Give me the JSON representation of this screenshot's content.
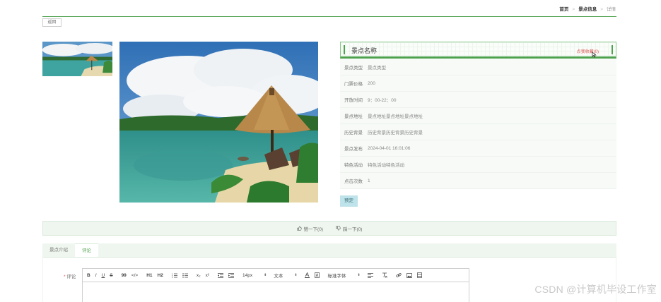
{
  "breadcrumb": {
    "home": "首页",
    "section": "景点信息",
    "current": "详情",
    "separator": ">"
  },
  "back_label": "返回",
  "spot": {
    "name": "景点名称",
    "favorite_label": "点我收藏(0)",
    "fields": [
      {
        "label": "景点类型",
        "value": "景点类型"
      },
      {
        "label": "门票价格",
        "value": "200"
      },
      {
        "label": "开放时间",
        "value": "9：00-22：00"
      },
      {
        "label": "景点地址",
        "value": "景点地址景点地址景点地址"
      },
      {
        "label": "历史背景",
        "value": "历史背景历史背景历史背景"
      },
      {
        "label": "景点发布",
        "value": "2024-04-01 16:01:06"
      },
      {
        "label": "特色活动",
        "value": "特色活动特色活动"
      },
      {
        "label": "点击次数",
        "value": "1"
      }
    ],
    "book_label": "预定"
  },
  "votes": {
    "like_label": "赞一下(0)",
    "dislike_label": "踩一下(0)"
  },
  "tabs": [
    {
      "label": "景点介绍",
      "active": false
    },
    {
      "label": "评论",
      "active": true
    }
  ],
  "comment": {
    "required_mark": "*",
    "label": "评论",
    "toolbar": {
      "bold": "B",
      "italic": "I",
      "underline": "U",
      "strike": "S",
      "blockquote": "99",
      "code": "</>",
      "h1": "H1",
      "h2": "H2",
      "sub": "x₂",
      "sup": "x²",
      "size_value": "14px",
      "format_value": "文本",
      "font_value": "标准字体",
      "caret": "⬍"
    }
  },
  "watermark": "CSDN @计算机毕设工作室",
  "colors": {
    "accent": "#4ea24e",
    "favorite": "#d9534f",
    "book_button": "#bfe3ea"
  },
  "icons": [
    "thumbs-up-icon",
    "thumbs-down-icon",
    "ordered-list-icon",
    "bullet-list-icon",
    "indent-icon",
    "outdent-icon",
    "text-color-icon",
    "background-color-icon",
    "align-icon",
    "clear-format-icon",
    "link-icon",
    "image-icon",
    "video-icon",
    "mouse-cursor-icon"
  ]
}
